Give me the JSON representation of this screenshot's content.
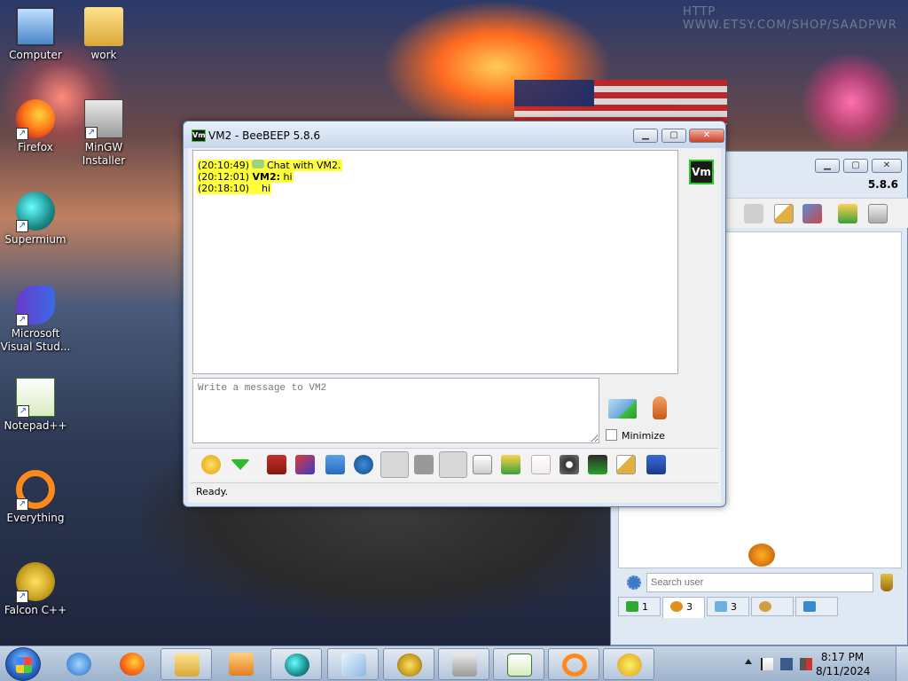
{
  "desktop": {
    "watermark": "HTTP WWW.ETSY.COM/SHOP/SAADPWR",
    "icons": [
      {
        "label": "Computer",
        "icon": "computer-icon"
      },
      {
        "label": "work",
        "icon": "folder-icon"
      },
      {
        "label": "Firefox",
        "icon": "firefox-icon"
      },
      {
        "label": "MinGW Installer",
        "icon": "mingw-installer-icon"
      },
      {
        "label": "Supermium",
        "icon": "supermium-icon"
      },
      {
        "label": "Microsoft Visual Stud...",
        "icon": "visual-studio-icon"
      },
      {
        "label": "Notepad++",
        "icon": "notepad-plus-plus-icon"
      },
      {
        "label": "Everything",
        "icon": "everything-search-icon"
      },
      {
        "label": "Falcon C++",
        "icon": "falcon-cpp-icon"
      }
    ]
  },
  "main_window": {
    "version": "5.8.6",
    "search_placeholder": "Search user",
    "tabs": [
      {
        "label": "1",
        "icon": "chat-icon"
      },
      {
        "label": "3",
        "icon": "users-icon",
        "active": true
      },
      {
        "label": "3",
        "icon": "messages-icon"
      },
      {
        "label": "",
        "icon": "groups-icon"
      },
      {
        "label": "",
        "icon": "network-icon"
      }
    ]
  },
  "chat_window": {
    "title": "VM2 - BeeBEEP 5.8.6",
    "badge": "Vm",
    "messages": [
      {
        "time": "(20:10:49)",
        "sender": "",
        "text": "Chat with VM2."
      },
      {
        "time": "(20:12:01)",
        "sender": "VM2:",
        "text": "hi"
      },
      {
        "time": "(20:18:10)",
        "sender": "",
        "text": "hi"
      }
    ],
    "compose_placeholder": "Write a message to VM2",
    "minimize_label": "Minimize",
    "status": "Ready."
  },
  "taskbar": {
    "time": "8:17 PM",
    "date": "8/11/2024"
  },
  "colors": {
    "highlight": "#ffff3a",
    "titlebar": "#c7d7ec",
    "close_button": "#c8402a"
  }
}
